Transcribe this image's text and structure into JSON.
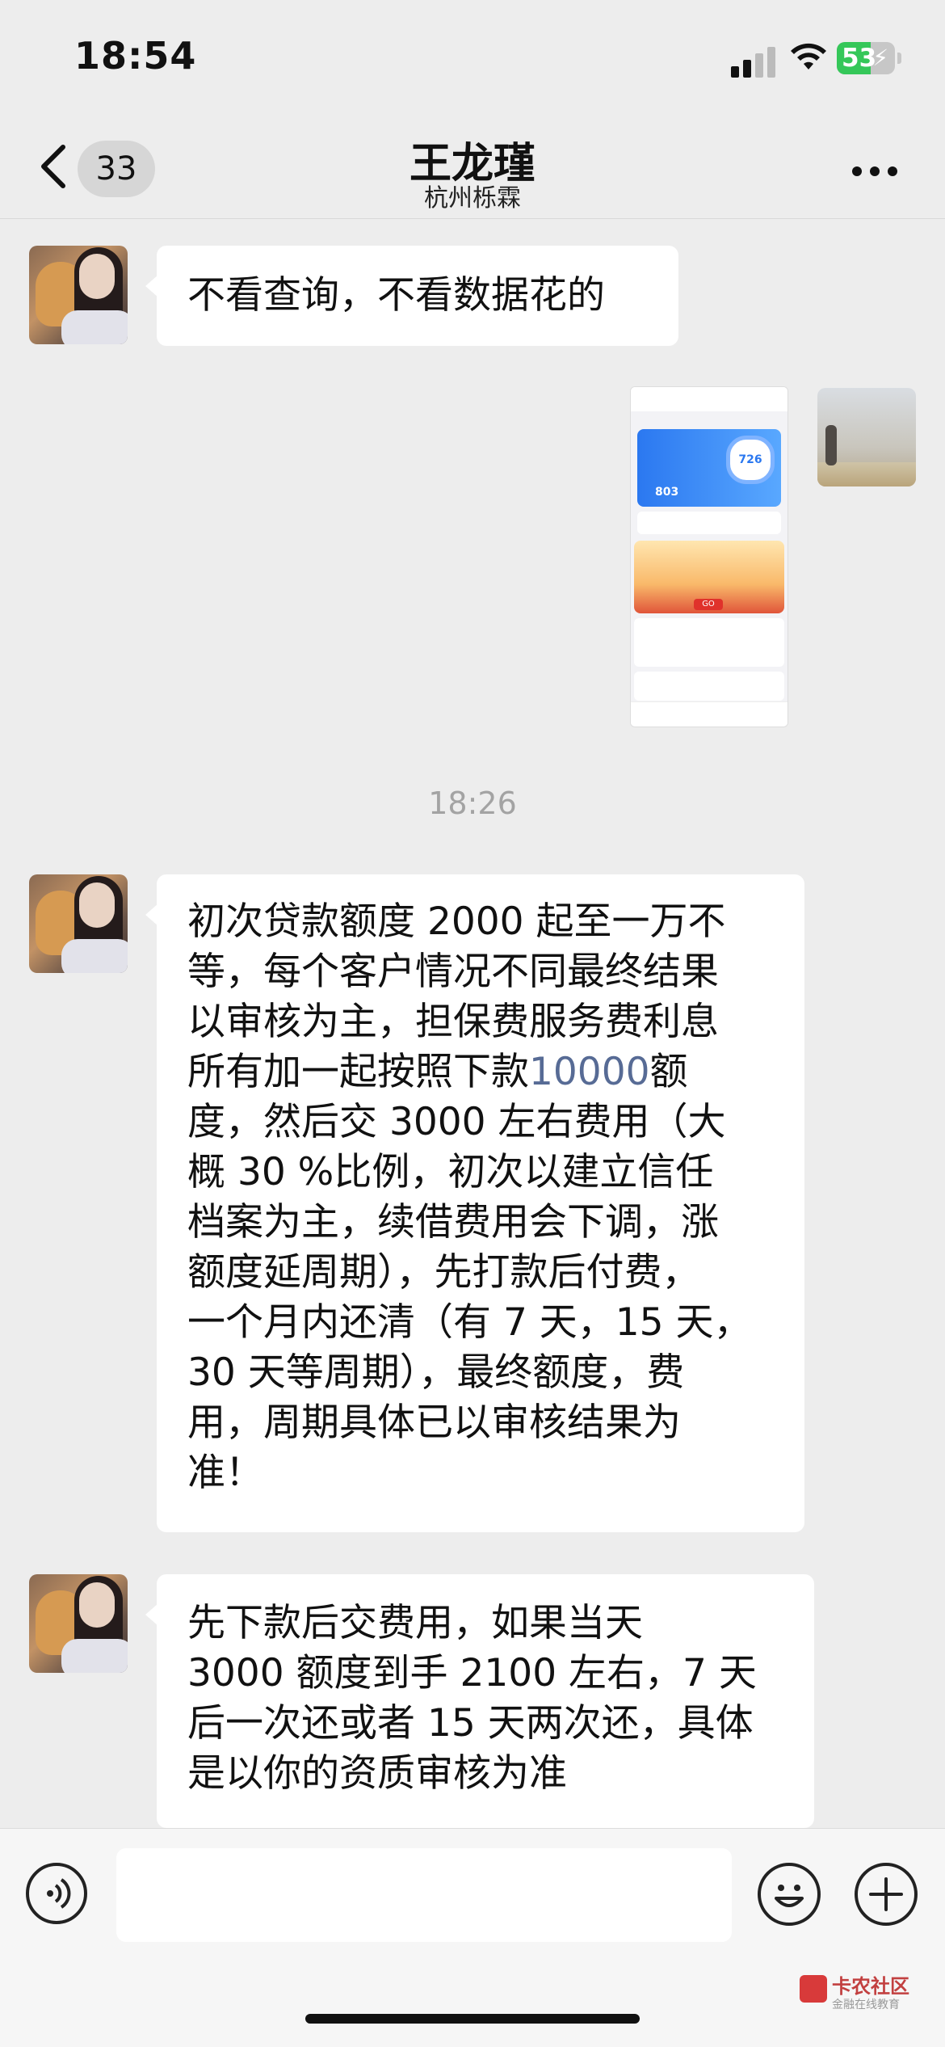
{
  "status_bar": {
    "time": "18:54",
    "battery": "53"
  },
  "nav": {
    "unread_count": "33",
    "title": "王龙瑾",
    "subtitle": "杭州栎霖"
  },
  "messages": [
    {
      "sender": "other",
      "lines": [
        "不看查询，不看数据花的"
      ]
    },
    {
      "sender": "me",
      "type": "image",
      "preview": {
        "score": "726",
        "amount": "803",
        "banner_button": "GO"
      }
    },
    {
      "timestamp": "18:26"
    },
    {
      "sender": "other",
      "lines": [
        "初次贷款额度 2000 起至一万不",
        "等，每个客户情况不同最终结果",
        "以审核为主，担保费服务费利息",
        "所有加一起按照下款",
        "度，然后交 3000 左右费用（大",
        "概 30 %比例，初次以建立信任",
        "档案为主，续借费用会下调，涨",
        "额度延周期），先打款后付费，",
        "一个月内还清（有 7 天，15 天，",
        "30 天等周期），最终额度，费",
        "用，周期具体已以审核结果为",
        "准！"
      ],
      "link_text": "10000",
      "after_link": "额"
    },
    {
      "sender": "other",
      "lines": [
        "先下款后交费用，如果当天",
        "3000 额度到手 2100 左右，7 天",
        "后一次还或者 15 天两次还，具体",
        "是以你的资质审核为准"
      ]
    }
  ],
  "watermark": {
    "name": "卡农社区",
    "tagline": "金融在线教育"
  }
}
